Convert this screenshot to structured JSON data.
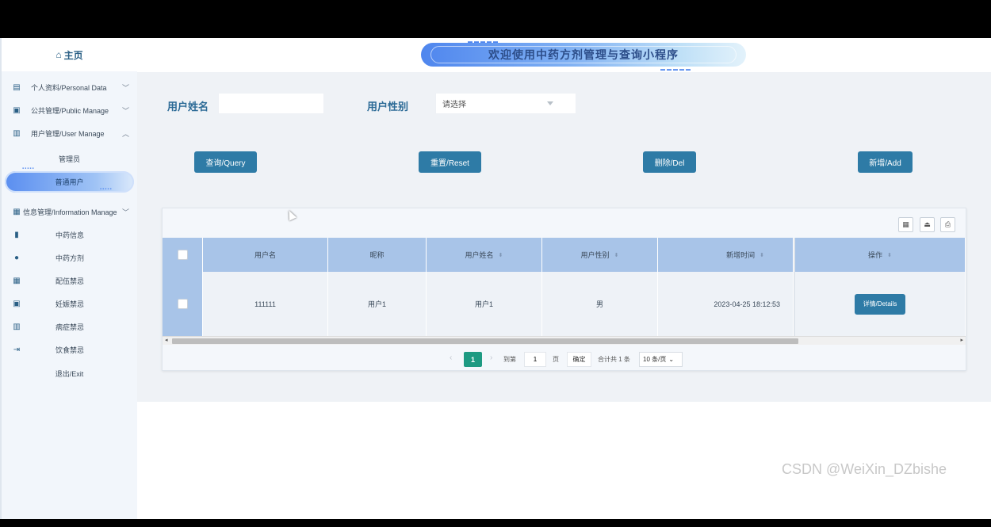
{
  "header": {
    "title": "欢迎使用中药方剂管理与查询小程序"
  },
  "sidebar": {
    "home": "主页",
    "menus": [
      {
        "label": "个人资料/Personal Data"
      },
      {
        "label": "公共管理/Public Manage"
      },
      {
        "label": "用户管理/User Manage"
      },
      {
        "label": "信息管理/Information Manage"
      }
    ],
    "user_sub": [
      "管理员",
      "普通用户"
    ],
    "info_sub": [
      "中药信息",
      "中药方剂",
      "配伍禁忌",
      "妊娠禁忌",
      "病症禁忌",
      "饮食禁忌"
    ],
    "exit": "退出/Exit"
  },
  "search": {
    "name_label": "用户姓名",
    "name_value": "",
    "gender_label": "用户性别",
    "gender_placeholder": "请选择"
  },
  "buttons": {
    "query": "查询/Query",
    "reset": "重置/Reset",
    "delete": "删除/Del",
    "add": "新增/Add"
  },
  "table": {
    "headers": [
      "用户名",
      "昵称",
      "用户姓名",
      "用户性别",
      "新增时间",
      "操作"
    ],
    "rows": [
      {
        "username": "111111",
        "nickname": "用户1",
        "realname": "用户1",
        "gender": "男",
        "created": "2023-04-25 18:12:53",
        "action": "详情/Details"
      }
    ]
  },
  "pagination": {
    "current": "1",
    "goto_label": "到第",
    "goto_value": "1",
    "page_unit": "页",
    "confirm": "确定",
    "total": "合计共 1 条",
    "page_size": "10 条/页"
  },
  "watermark": "CSDN @WeiXin_DZbishe"
}
